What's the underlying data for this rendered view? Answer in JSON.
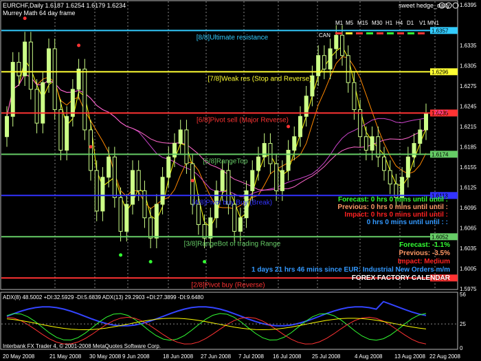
{
  "header": {
    "symbol_info": "EURCHF,Daily  1.6187 1.6254 1.6179 1.6234",
    "indicator_name": "Murrey Math 64 day frame",
    "window_title": "sweet hedge_daily"
  },
  "timeframes": [
    "M1",
    "M5",
    "M15",
    "M30",
    "H1",
    "H4",
    "D1",
    "V1",
    "MN1"
  ],
  "can_label": "CAN",
  "murrey_levels": [
    {
      "label": "[8/8]Ultimate resistance",
      "price": 1.6357,
      "price_tag": "1.6357",
      "color": "#33ccff"
    },
    {
      "label": "[7/8]Weak res (Stop and Reverse)",
      "price": 1.6296,
      "price_tag": "1.6296",
      "color": "#ffff33"
    },
    {
      "label": "[6/8]Pivot sell (Major Reverse)",
      "price": 1.6235,
      "price_tag": "1.6235",
      "color": "#ff3333"
    },
    {
      "label": "[5/8]RangeTop",
      "price": 1.6174,
      "price_tag": "1.6174",
      "color": "#66cc66"
    },
    {
      "label": "[4/8]Pivot buy Buy (Break)",
      "price": 1.6113,
      "price_tag": "1.6113",
      "color": "#3333ff"
    },
    {
      "label": "[3/8]RangeBot of trading Range",
      "price": 1.6052,
      "price_tag": "1.6052",
      "color": "#66cc66"
    },
    {
      "label": "[2/8]Pivot buy (Reverse)",
      "price": 1.5991,
      "price_tag": "1.5991",
      "color": "#ff3333"
    }
  ],
  "price_axis": [
    "1.6395",
    "1.6335",
    "1.6305",
    "1.6275",
    "1.6245",
    "1.6215",
    "1.6185",
    "1.6155",
    "1.6125",
    "1.6095",
    "1.6065",
    "1.6035",
    "1.6005",
    "1.5975"
  ],
  "current_marker": "240.7",
  "forecast_block_1": [
    {
      "text": "Forecast: 0 hrs 0 mins until until :",
      "color": "#33ff33"
    },
    {
      "text": "Previous: 0 hrs 0 mins until until :",
      "color": "#ff9966"
    },
    {
      "text": "Impact: 0 hrs 0 mins until until :",
      "color": "#ff2222"
    },
    {
      "text": "0 hrs 0 mins until until : :",
      "color": "#3399ff"
    }
  ],
  "forecast_block_2": [
    {
      "text": "Forecast: -1.1%",
      "color": "#33ff33"
    },
    {
      "text": "Previous: -3.5%",
      "color": "#ff9966"
    },
    {
      "text": "Impact: Medium",
      "color": "#ff2222"
    },
    {
      "text": "1 days 21 hrs 46 mins since EUR: Industrial New Orders m/m",
      "color": "#3399ff"
    },
    {
      "text": "FOREX FACTORY CALENDAR",
      "color": "#ffffff"
    }
  ],
  "sub_window": {
    "label": "ADX(8) 48.5002 +DI:32.5929 -DI:5.6839  ADX(13) 29.2903 +DI:27.3899 -DI:9.6480",
    "axis": [
      "56",
      "25",
      "0"
    ]
  },
  "footer": "Interbank FX Trader 4, © 2001-2008 MetaQuotes Software Corp.",
  "date_axis": [
    "20 May 2008",
    "21 May 2008",
    "30 May 2008",
    "9 Jun 2008",
    "18 Jun 2008",
    "27 Jun 2008",
    "7 Jul 2008",
    "16 Jul 2008",
    "25 Jul 2008",
    "4 Aug 2008",
    "13 Aug 2008",
    "22 Aug 2008"
  ],
  "colors": {
    "candle_bull": "#ccff88",
    "candle_bear": "#000000",
    "ma_yellow": "#ffff00",
    "ma_orange": "#ff8800",
    "ma_magenta": "#cc44cc",
    "ma_pink": "#ff66cc"
  }
}
